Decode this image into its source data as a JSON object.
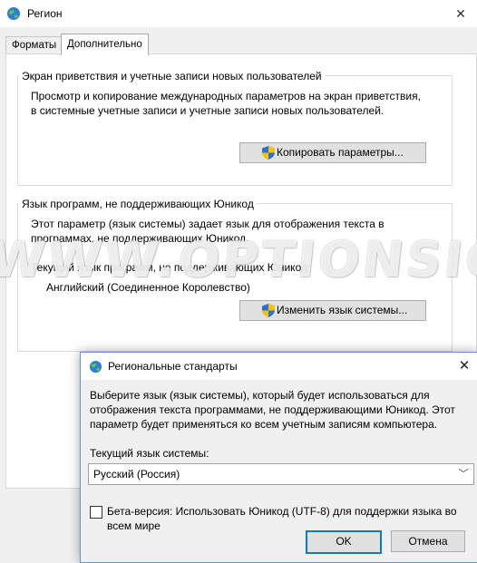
{
  "window": {
    "title": "Регион",
    "tabs": [
      {
        "label": "Форматы"
      },
      {
        "label": "Дополнительно"
      }
    ]
  },
  "welcome_group": {
    "title": "Экран приветствия и учетные записи новых пользователей",
    "description_line1": "Просмотр и копирование международных параметров на экран приветствия,",
    "description_line2": "в системные учетные записи и учетные записи новых пользователей.",
    "copy_button": "Копировать параметры..."
  },
  "nonunicode_group": {
    "title": "Язык программ, не поддерживающих Юникод",
    "description_line1": "Этот параметр (язык системы) задает язык для отображения текста в",
    "description_line2": "программах, не поддерживающих Юникод.",
    "current_label": "Текущий язык программ, не поддерживающих Юникод:",
    "current_value": "Английский (Соединенное Королевство)",
    "change_button": "Изменить язык системы..."
  },
  "dialog": {
    "title": "Региональные стандарты",
    "description_line1": "Выберите язык (язык системы), который будет использоваться для",
    "description_line2": "отображения текста программами, не поддерживающими Юникод. Этот",
    "description_line3": "параметр будет применяться ко всем учетным записям компьютера.",
    "current_label": "Текущий язык системы:",
    "current_value": "Русский (Россия)",
    "beta_label_line1": "Бета-версия: Использовать Юникод (UTF-8) для поддержки языка во",
    "beta_label_line2": "всем мире",
    "ok_button": "OK",
    "cancel_button": "Отмена"
  },
  "watermark": "WWW.OPTIONSIGNALS.COM",
  "icons": {
    "window_icon": "globe-icon",
    "shield": "uac-shield-icon",
    "close": "close-icon",
    "dropdown": "chevron-down-icon"
  },
  "colors": {
    "titlebar_bg": "#ffffff",
    "window_bg": "#f0f0f0",
    "focus_border": "#0078d7",
    "shield_blue": "#2f6fd1",
    "shield_yellow": "#f5c400"
  }
}
